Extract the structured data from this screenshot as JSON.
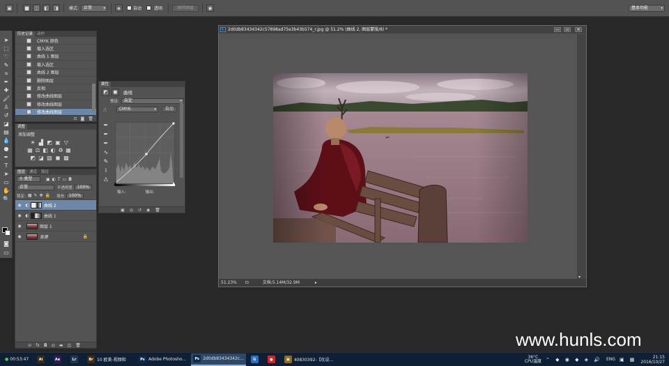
{
  "options_bar": {
    "mode_label": "模式:",
    "mode_value": "正常",
    "auto_label": "自动",
    "transparent_label": "透明",
    "erase_button": "抹除图层",
    "workspace": "基本功能"
  },
  "history_panel": {
    "tabs": [
      "历史记录",
      "动作"
    ],
    "items": [
      "CMYK 颜色",
      "载入选区",
      "曲线 1 图层",
      "载入选区",
      "曲线 2 图层",
      "删除图层",
      "反相",
      "修改曲线图层",
      "修改曲线图层",
      "修改曲线图层"
    ],
    "selected_index": 9
  },
  "adjustments_panel": {
    "tabs": [
      "调整"
    ],
    "add_label": "添加调整",
    "row1_icons": [
      "☀",
      "▟",
      "◩",
      "▣",
      "▽"
    ],
    "row2_icons": [
      "▦",
      "⚖",
      "◧",
      "◐",
      "♻",
      "▦"
    ],
    "row3_icons": [
      "◩",
      "◪",
      "▨",
      "◼",
      "▩"
    ]
  },
  "layers_panel": {
    "tabs": [
      "图层",
      "通道",
      "路径"
    ],
    "filter_label": "类型",
    "blend_mode": "正常",
    "opacity_label": "不透明度:",
    "opacity_value": "100%",
    "lock_label": "锁定:",
    "fill_label": "填充:",
    "fill_value": "100%",
    "layers": [
      {
        "name": "曲线 2",
        "selected": true
      },
      {
        "name": "曲线 1",
        "selected": false
      },
      {
        "name": "图层 1",
        "selected": false
      },
      {
        "name": "背景",
        "selected": false
      }
    ],
    "footer_icons": [
      "⊝",
      "fx",
      "◘",
      "◎",
      "▬",
      "◫",
      "🗑"
    ]
  },
  "properties_panel": {
    "tabs": [
      "属性"
    ],
    "title": "曲线",
    "preset_label": "预设:",
    "preset_value": "自定",
    "channel_value": "CMYK",
    "auto_button": "自动",
    "input_label": "输入:",
    "output_label": "输出:"
  },
  "document": {
    "title": "2d0db83434342c57898ad75e3b43b574_r.jpg @ 51.2% (曲线 2, 图层蒙版/8) *",
    "zoom": "51.23%",
    "doc_info": "文档:5.14M/32.9M"
  },
  "taskbar": {
    "clock_left": "00:53:47",
    "items": [
      {
        "label": "",
        "icon": "Ai",
        "color": "#3a2b14"
      },
      {
        "label": "",
        "icon": "Ae",
        "color": "#2d1f54"
      },
      {
        "label": "",
        "icon": "Lr",
        "color": "#23364f"
      },
      {
        "label": "10 欧美-视频和",
        "icon": "Br",
        "color": "#4a2a0e"
      },
      {
        "label": "Adobe Photosho...",
        "icon": "Ps",
        "color": "#0e2a4a"
      },
      {
        "label": "2d0db83434342c...",
        "icon": "Ps",
        "color": "#0e2a4a"
      },
      {
        "label": "",
        "icon": "G",
        "color": "#2f6fbf"
      },
      {
        "label": "",
        "icon": "●",
        "color": "#c92a2a"
      },
      {
        "label": "40830392-【优设...",
        "icon": "▣",
        "color": "#8a6d2a"
      }
    ],
    "temp": "36°C",
    "cpu_label": "CPU温度",
    "lang": "ENG",
    "time": "21:15",
    "date": "2016/10/27"
  },
  "watermark": "www.hunls.com",
  "colors": {
    "panel_bg": "#535353",
    "selected": "#6c87a8",
    "taskbar": "#0f1f35"
  }
}
